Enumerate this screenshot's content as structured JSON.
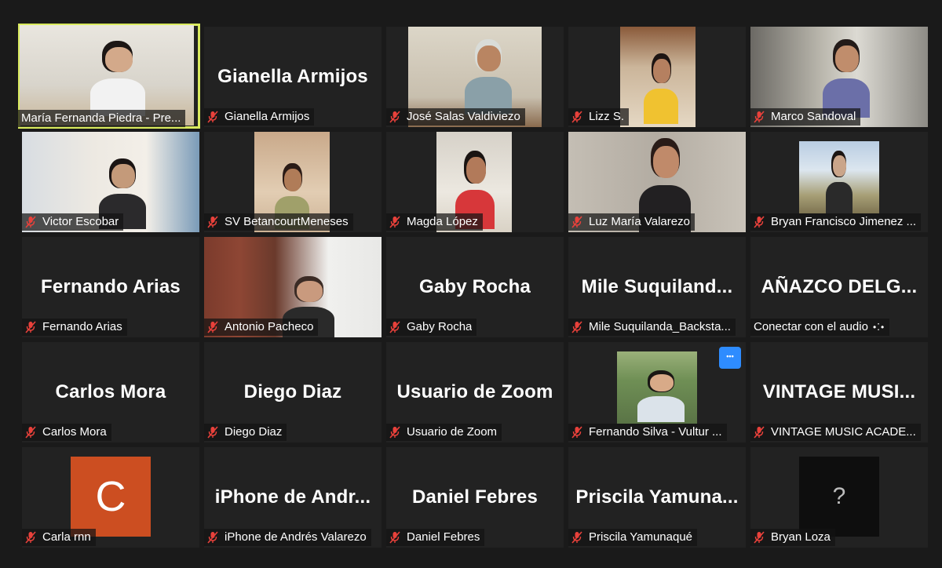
{
  "participants": [
    {
      "name": "María Fernanda Piedra - Pre...",
      "display": "",
      "muted": false,
      "video": true,
      "active": true
    },
    {
      "name": "Gianella Armijos",
      "display": "Gianella Armijos",
      "muted": true,
      "video": false
    },
    {
      "name": "José Salas Valdiviezo",
      "display": "",
      "muted": true,
      "video": true
    },
    {
      "name": "Lizz S.",
      "display": "",
      "muted": true,
      "video": true
    },
    {
      "name": "Marco Sandoval",
      "display": "",
      "muted": true,
      "video": true
    },
    {
      "name": "Victor Escobar",
      "display": "",
      "muted": true,
      "video": true
    },
    {
      "name": "SV BetancourtMeneses",
      "display": "",
      "muted": true,
      "video": true
    },
    {
      "name": "Magda López",
      "display": "",
      "muted": true,
      "video": true
    },
    {
      "name": "Luz María Valarezo",
      "display": "",
      "muted": true,
      "video": true
    },
    {
      "name": "Bryan Francisco Jimenez ...",
      "display": "",
      "muted": true,
      "video": true
    },
    {
      "name": "Fernando Arias",
      "display": "Fernando Arias",
      "muted": true,
      "video": false
    },
    {
      "name": "Antonio Pacheco",
      "display": "",
      "muted": true,
      "video": true
    },
    {
      "name": "Gaby Rocha",
      "display": "Gaby Rocha",
      "muted": true,
      "video": false
    },
    {
      "name": "Mile Suquilanda_Backsta...",
      "display": "Mile  Suquiland...",
      "muted": true,
      "video": false
    },
    {
      "name": "Conectar con el audio",
      "display": "AÑAZCO  DELG...",
      "muted": false,
      "video": false,
      "connect_audio": true
    },
    {
      "name": "Carlos Mora",
      "display": "Carlos Mora",
      "muted": true,
      "video": false
    },
    {
      "name": "Diego Diaz",
      "display": "Diego Diaz",
      "muted": true,
      "video": false
    },
    {
      "name": "Usuario de Zoom",
      "display": "Usuario de Zoom",
      "muted": true,
      "video": false
    },
    {
      "name": "Fernando Silva - Vultur ...",
      "display": "",
      "muted": true,
      "video": true,
      "more_button": true
    },
    {
      "name": "VINTAGE MUSIC ACADE...",
      "display": "VINTAGE  MUSI...",
      "muted": true,
      "video": false
    },
    {
      "name": "Carla rnn",
      "display": "",
      "muted": true,
      "video": false,
      "avatar_letter": "C"
    },
    {
      "name": "iPhone de Andrés Valarezo",
      "display": "iPhone  de  Andr...",
      "muted": true,
      "video": false
    },
    {
      "name": "Daniel Febres",
      "display": "Daniel Febres",
      "muted": true,
      "video": false
    },
    {
      "name": "Priscila Yamunaqué",
      "display": "Priscila  Yamuna...",
      "muted": true,
      "video": false
    },
    {
      "name": "Bryan Loza",
      "display": "",
      "muted": true,
      "video": false,
      "avatar_symbol": "?"
    }
  ],
  "colors": {
    "background": "#1a1a1a",
    "tile": "#222222",
    "active_border": "#d9ea5e",
    "muted_icon": "#e8413b",
    "avatar_c": "#cc4e21",
    "more_button": "#2e8cff"
  }
}
